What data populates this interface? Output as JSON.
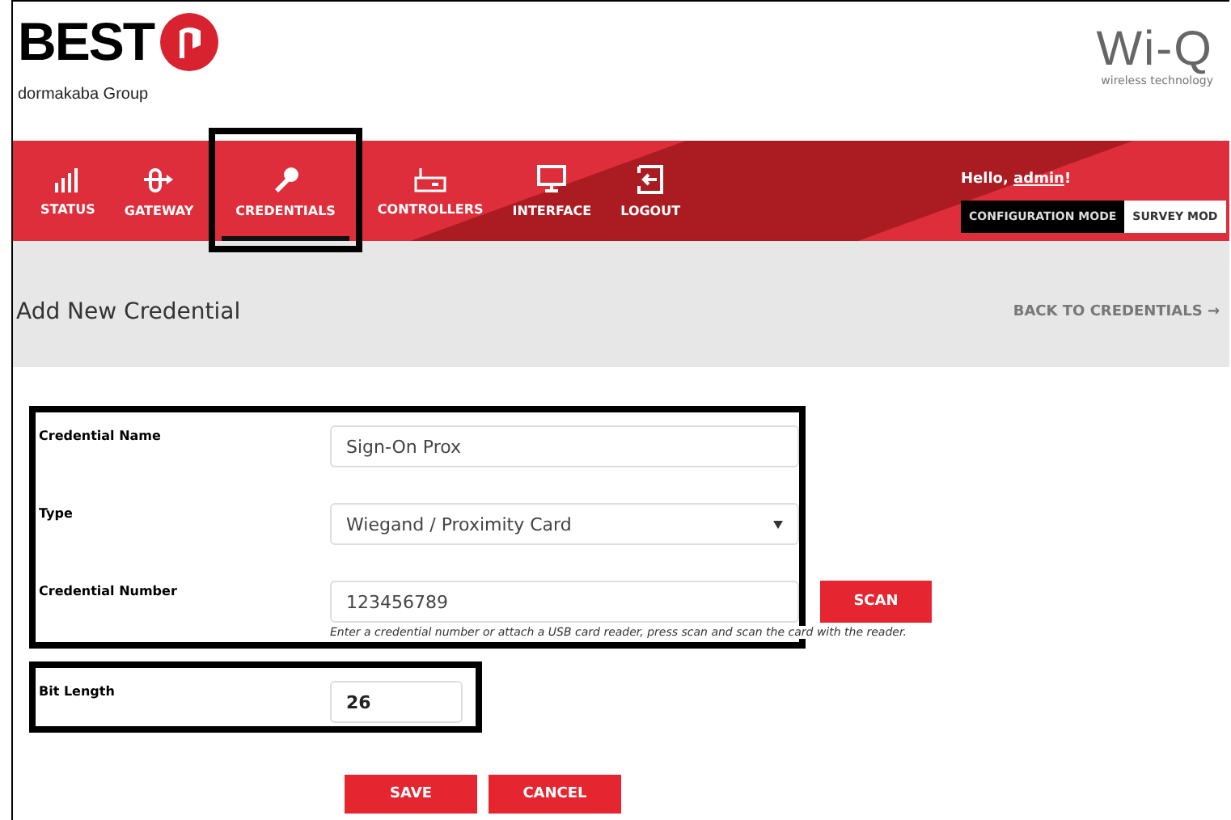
{
  "brand": {
    "name": "BEST",
    "group": "dormakaba Group"
  },
  "product": {
    "name": "Wi-Q",
    "tagline": "wireless technology"
  },
  "nav": [
    {
      "label": "STATUS",
      "selected": false,
      "highlighted": false
    },
    {
      "label": "GATEWAY",
      "selected": false,
      "highlighted": false
    },
    {
      "label": "CREDENTIALS",
      "selected": true,
      "highlighted": true
    },
    {
      "label": "CONTROLLERS",
      "selected": false,
      "highlighted": false
    },
    {
      "label": "INTERFACE",
      "selected": false,
      "highlighted": false
    },
    {
      "label": "LOGOUT",
      "selected": false,
      "highlighted": false
    }
  ],
  "user": {
    "greeting": "Hello, ",
    "name": "admin",
    "suffix": "!"
  },
  "modes": [
    {
      "label": "CONFIGURATION MODE",
      "selected": true
    },
    {
      "label": "SURVEY MOD",
      "selected": false
    }
  ],
  "page_title": "Add New Credential",
  "back_link": "BACK TO CREDENTIALS →",
  "groups": [
    {
      "highlighted": true,
      "fields": [
        {
          "label": "Credential Name",
          "kind": "text",
          "value": "Sign-On Prox"
        },
        {
          "label": "Type",
          "kind": "select",
          "value": "Wiegand / Proximity Card"
        },
        {
          "label": "Credential Number",
          "kind": "text",
          "value": "123456789",
          "button": "SCAN",
          "hint": "Enter a credential number or attach a USB card reader, press scan and scan the card with the reader."
        }
      ]
    },
    {
      "highlighted": true,
      "fields": [
        {
          "label": "Bit Length",
          "kind": "short",
          "value": "26"
        }
      ]
    }
  ],
  "buttons": [
    "SAVE",
    "CANCEL"
  ]
}
